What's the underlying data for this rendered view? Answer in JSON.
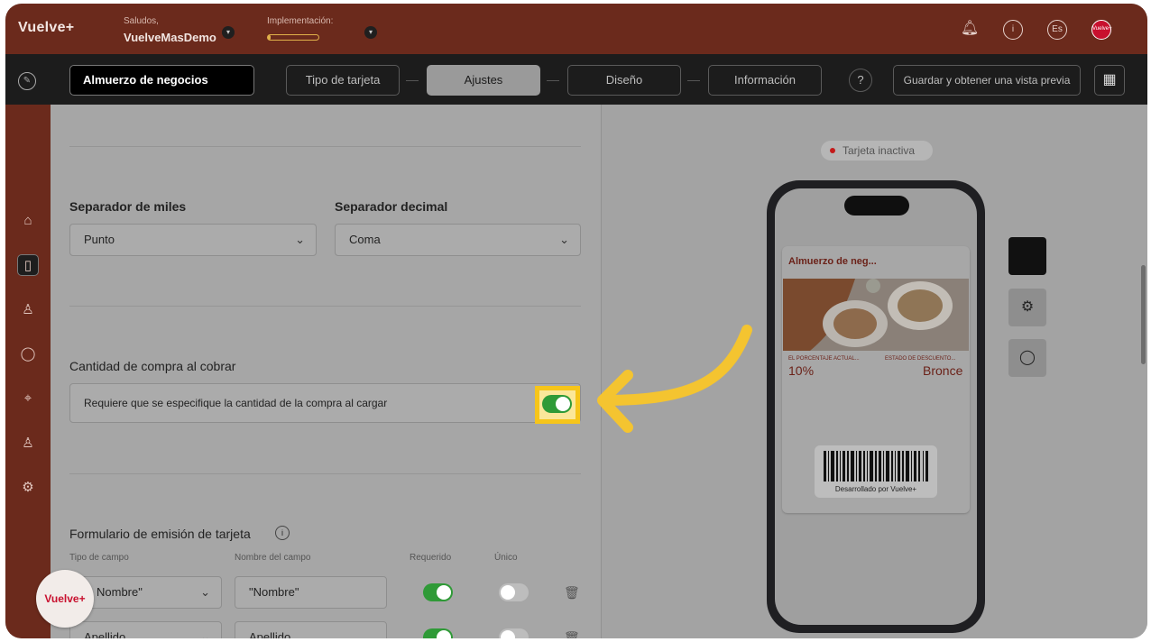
{
  "topbar": {
    "logo": "Vuelve+",
    "greeting_label": "Saludos,",
    "greeting_name": "VuelveMasDemo",
    "impl_label": "Implementación:",
    "implementation_progress": 0.05,
    "lang": "Es",
    "avatar_text": "Vuelve+"
  },
  "toolbar": {
    "card_name": "Almuerzo de negocios",
    "steps": [
      "Tipo de tarjeta",
      "Ajustes",
      "Diseño",
      "Información"
    ],
    "active_step": "Ajustes",
    "help": "?",
    "save_preview": "Guardar y obtener una vista previa"
  },
  "form": {
    "thousands_label": "Separador de miles",
    "thousands_value": "Punto",
    "decimal_label": "Separador decimal",
    "decimal_value": "Coma",
    "amount_label": "Cantidad de compra al cobrar",
    "amount_text": "Requiere que se especifique la cantidad de la compra al cargar",
    "amount_enabled": true,
    "issue_title": "Formulario de emisión de tarjeta",
    "col_type": "Tipo de campo",
    "col_name": "Nombre del campo",
    "col_required": "Requerido",
    "col_unique": "Único",
    "rows": [
      {
        "type": "Nombre\"",
        "name": "\"Nombre\"",
        "required": true,
        "unique": false
      },
      {
        "type": "Apellido",
        "name": "Apellido",
        "required": true,
        "unique": false
      }
    ]
  },
  "badge": "Vuelve+",
  "preview": {
    "status": "Tarjeta inactiva",
    "card_title": "Almuerzo de neg...",
    "label_left": "EL PORCENTAJE ACTUAL...",
    "label_right": "ESTADO DE DESCUENTO...",
    "value_left": "10%",
    "value_right": "Bronce",
    "footer": "Desarrollado por Vuelve+"
  },
  "colors": {
    "brand": "#6b2a1c",
    "highlight": "#f6c51a",
    "toggle_on": "#2f9a37",
    "arrow": "#f4c430"
  }
}
